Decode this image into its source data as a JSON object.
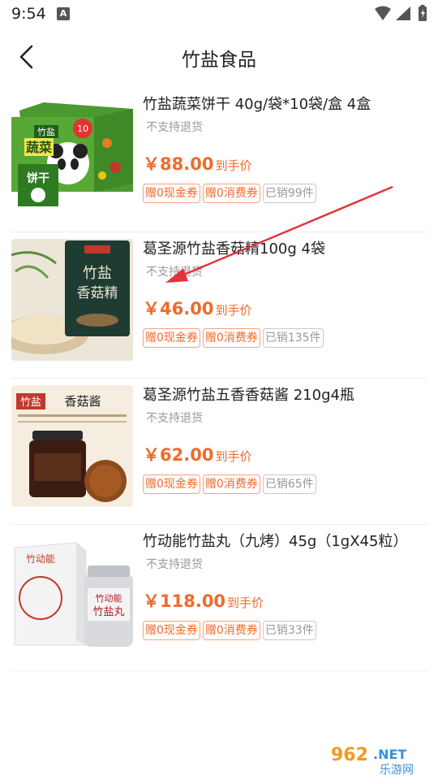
{
  "status_bar": {
    "time": "9:54",
    "notification_badge": "A"
  },
  "header": {
    "title": "竹盐食品"
  },
  "products": [
    {
      "title": "竹盐蔬菜饼干 40g/袋*10袋/盒 4盒",
      "subtitle": "不支持退货",
      "price": "￥88.00",
      "price_suffix": "到手价",
      "tag_cash": "赠0现金券",
      "tag_consume": "赠0消费券",
      "sold": "已销99件",
      "image_text": {
        "a": "竹盐",
        "b": "蔬菜",
        "c": "饼干",
        "d": "10"
      }
    },
    {
      "title": "葛圣源竹盐香菇精100g 4袋",
      "subtitle": "不支持退货",
      "price": "￥46.00",
      "price_suffix": "到手价",
      "tag_cash": "赠0现金券",
      "tag_consume": "赠0消费券",
      "sold": "已销135件",
      "image_text": {
        "a": "竹盐",
        "b": "香菇精"
      }
    },
    {
      "title": "葛圣源竹盐五香香菇酱 210g4瓶",
      "subtitle": "不支持退货",
      "price": "￥62.00",
      "price_suffix": "到手价",
      "tag_cash": "赠0现金券",
      "tag_consume": "赠0消费券",
      "sold": "已销65件",
      "image_text": {
        "a": "竹盐",
        "b": "香菇酱"
      }
    },
    {
      "title": "竹动能竹盐丸（九烤）45g（1gX45粒）",
      "subtitle": "不支持退货",
      "price": "￥118.00",
      "price_suffix": "到手价",
      "tag_cash": "赠0现金券",
      "tag_consume": "赠0消费券",
      "sold": "已销33件",
      "image_text": {
        "a": "竹动能",
        "b": "竹盐丸"
      }
    }
  ],
  "watermark": {
    "number": "962",
    "tld": ".NET",
    "name": "乐游网"
  },
  "colors": {
    "accent": "#f06a2a",
    "tag_border": "#f4a27d",
    "muted": "#999999",
    "arrow": "#e0353b"
  }
}
